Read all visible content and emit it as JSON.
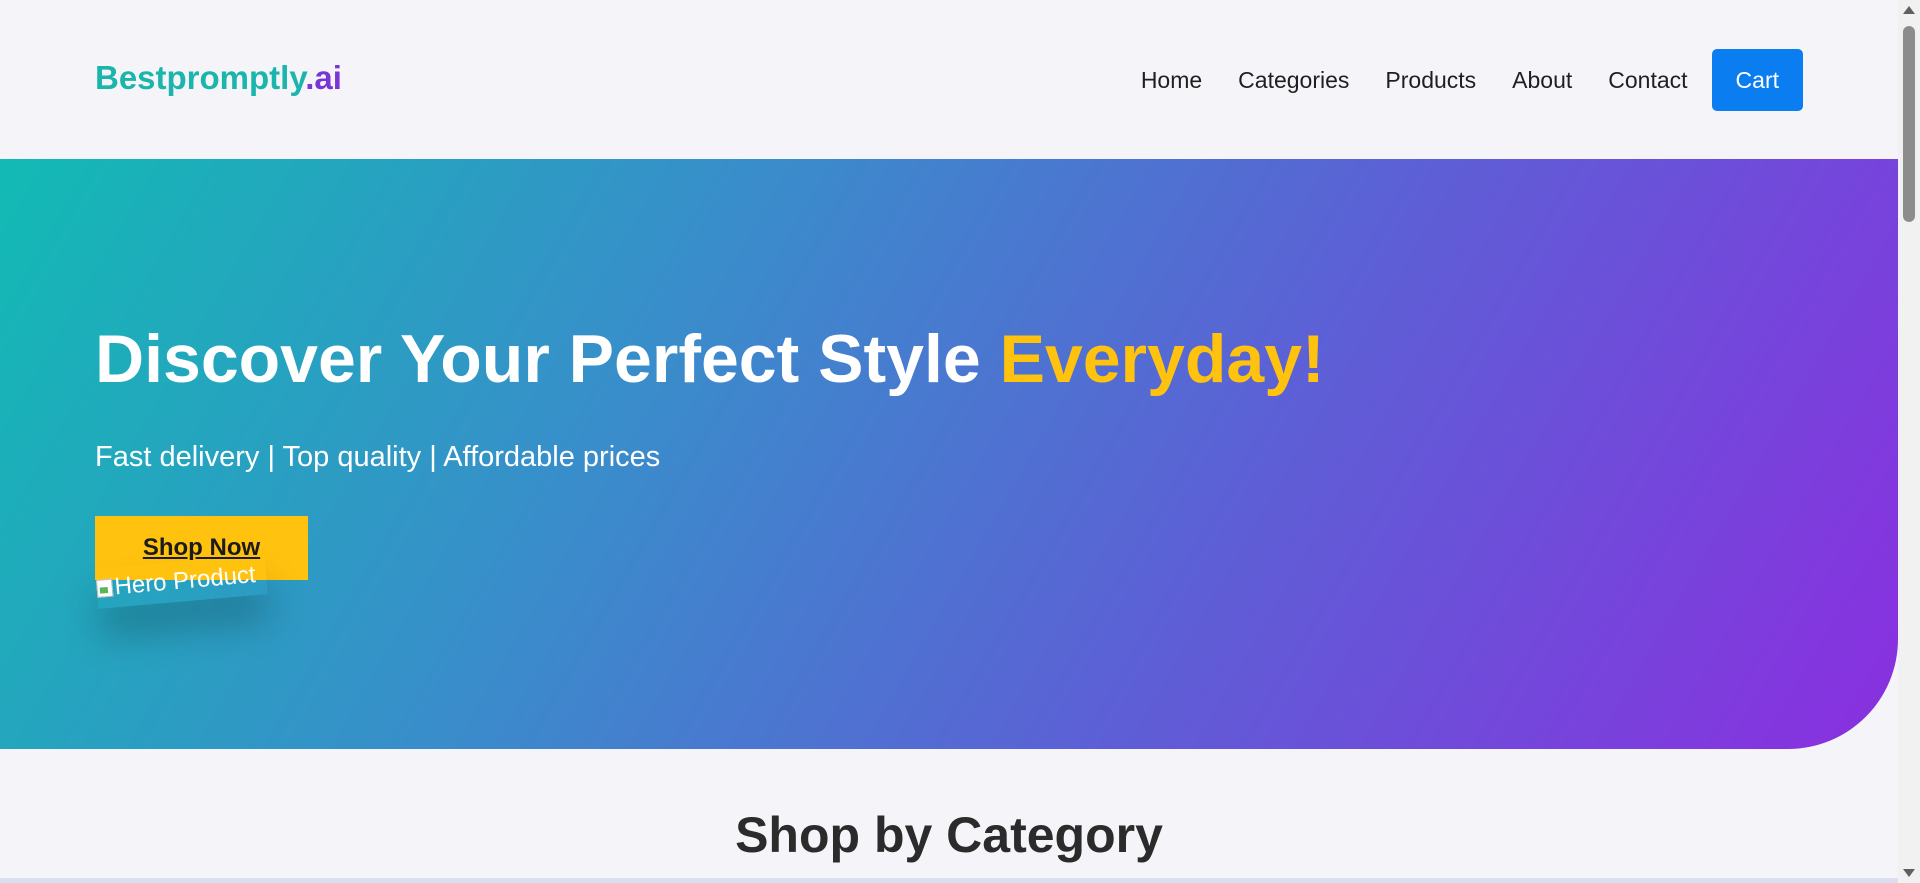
{
  "header": {
    "logo_brand": "Bestpromptly",
    "logo_tld": ".ai",
    "nav": [
      "Home",
      "Categories",
      "Products",
      "About",
      "Contact"
    ],
    "cart_label": "Cart"
  },
  "hero": {
    "title_main": "Discover Your Perfect Style ",
    "title_accent": "Everyday!",
    "subtitle": "Fast delivery | Top quality | Affordable prices",
    "cta_label": "Shop Now",
    "image_alt": "Hero Product"
  },
  "section": {
    "title": "Shop by Category"
  },
  "colors": {
    "brand_teal": "#1bb5ab",
    "brand_purple": "#7a35d6",
    "accent_yellow": "#ffc20e",
    "cart_blue": "#0a7df0"
  }
}
